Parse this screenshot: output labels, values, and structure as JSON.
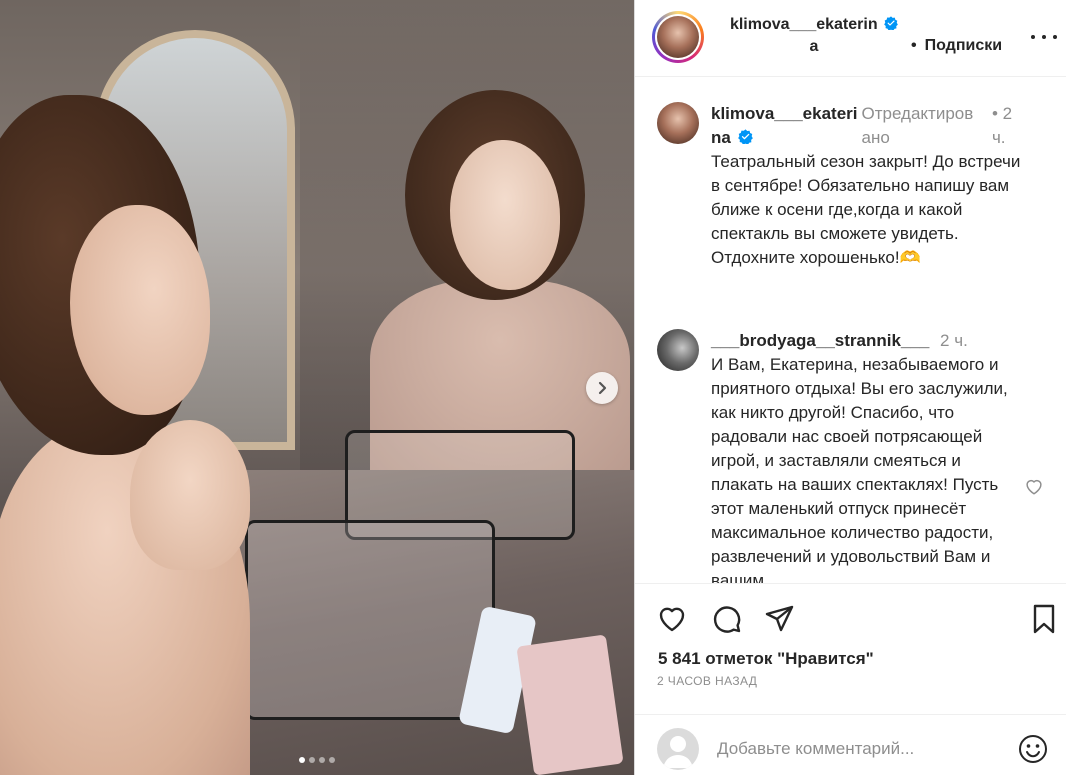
{
  "post": {
    "image_alt": "photo carousel",
    "carousel": {
      "total": 4,
      "active_index": 0
    }
  },
  "header": {
    "username_line1": "klimova___ekaterin",
    "username_line2": "a",
    "separator": "•",
    "follow_label": "Подписки"
  },
  "comments": [
    {
      "username_line1": "klimova___ekateri",
      "username_line2": "na",
      "edited_line1": "Отредактиров",
      "edited_line2": "ано",
      "dot": "•",
      "time_line1": "2",
      "time_line2": "ч.",
      "text": "Театральный сезон закрыт! До встречи в сентябре! Обязательно напишу вам ближе к осени где,когда и какой спектакль вы сможете увидеть. Отдохните хорошенько!🫶"
    },
    {
      "username": "___brodyaga__strannik___",
      "time": "2 ч.",
      "text": "И Вам, Екатерина, незабываемого и приятного отдыха! Вы его заслужили, как никто другой! Спасибо, что радовали нас своей потрясающей игрой, и заставляли смеяться и плакать на ваших спектаклях! Пусть этот маленький отпуск принесёт максимальное количество радости, развлечений и удовольствий Вам и вашим"
    }
  ],
  "likes_text": "5 841 отметок \"Нравится\"",
  "time_ago": "2 ЧАСОВ НАЗАД",
  "add_comment": {
    "placeholder": "Добавьте комментарий..."
  },
  "colors": {
    "verified": "#0095f6",
    "text": "#262626",
    "muted": "#8e8e8e",
    "border": "#dbdbdb"
  }
}
